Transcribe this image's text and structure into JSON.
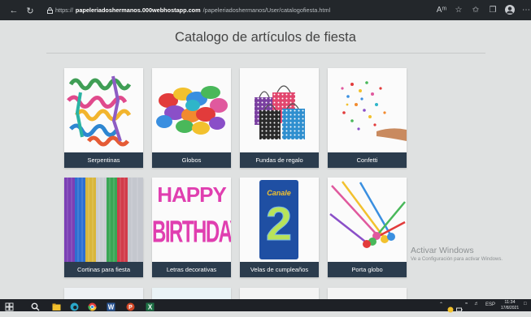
{
  "browser": {
    "url_prefix": "https://",
    "url_host": "papeleriadoshermanos.000webhostapp.com",
    "url_path": "/papeleriadoshermanos/User/catalogofiesta.html"
  },
  "page": {
    "title": "Catalogo de artículos de fiesta"
  },
  "catalog": {
    "items": [
      {
        "label": "Serpentinas"
      },
      {
        "label": "Globos"
      },
      {
        "label": "Fundas de regalo"
      },
      {
        "label": "Confetti"
      },
      {
        "label": "Cortinas para fiesta"
      },
      {
        "label": "Letras decorativas"
      },
      {
        "label": "Velas de cumpleaños"
      },
      {
        "label": "Porta globo"
      }
    ],
    "letters_art": [
      "HAPPY",
      "BIRTHDAY"
    ],
    "candle_art": {
      "brand": "Canale",
      "number": "2"
    }
  },
  "watermark": {
    "line1": "Activar Windows",
    "line2": "Ve a Configuración para activar Windows."
  },
  "taskbar": {
    "language": "ESP",
    "time": "11:34",
    "date": "17/8/2021"
  }
}
